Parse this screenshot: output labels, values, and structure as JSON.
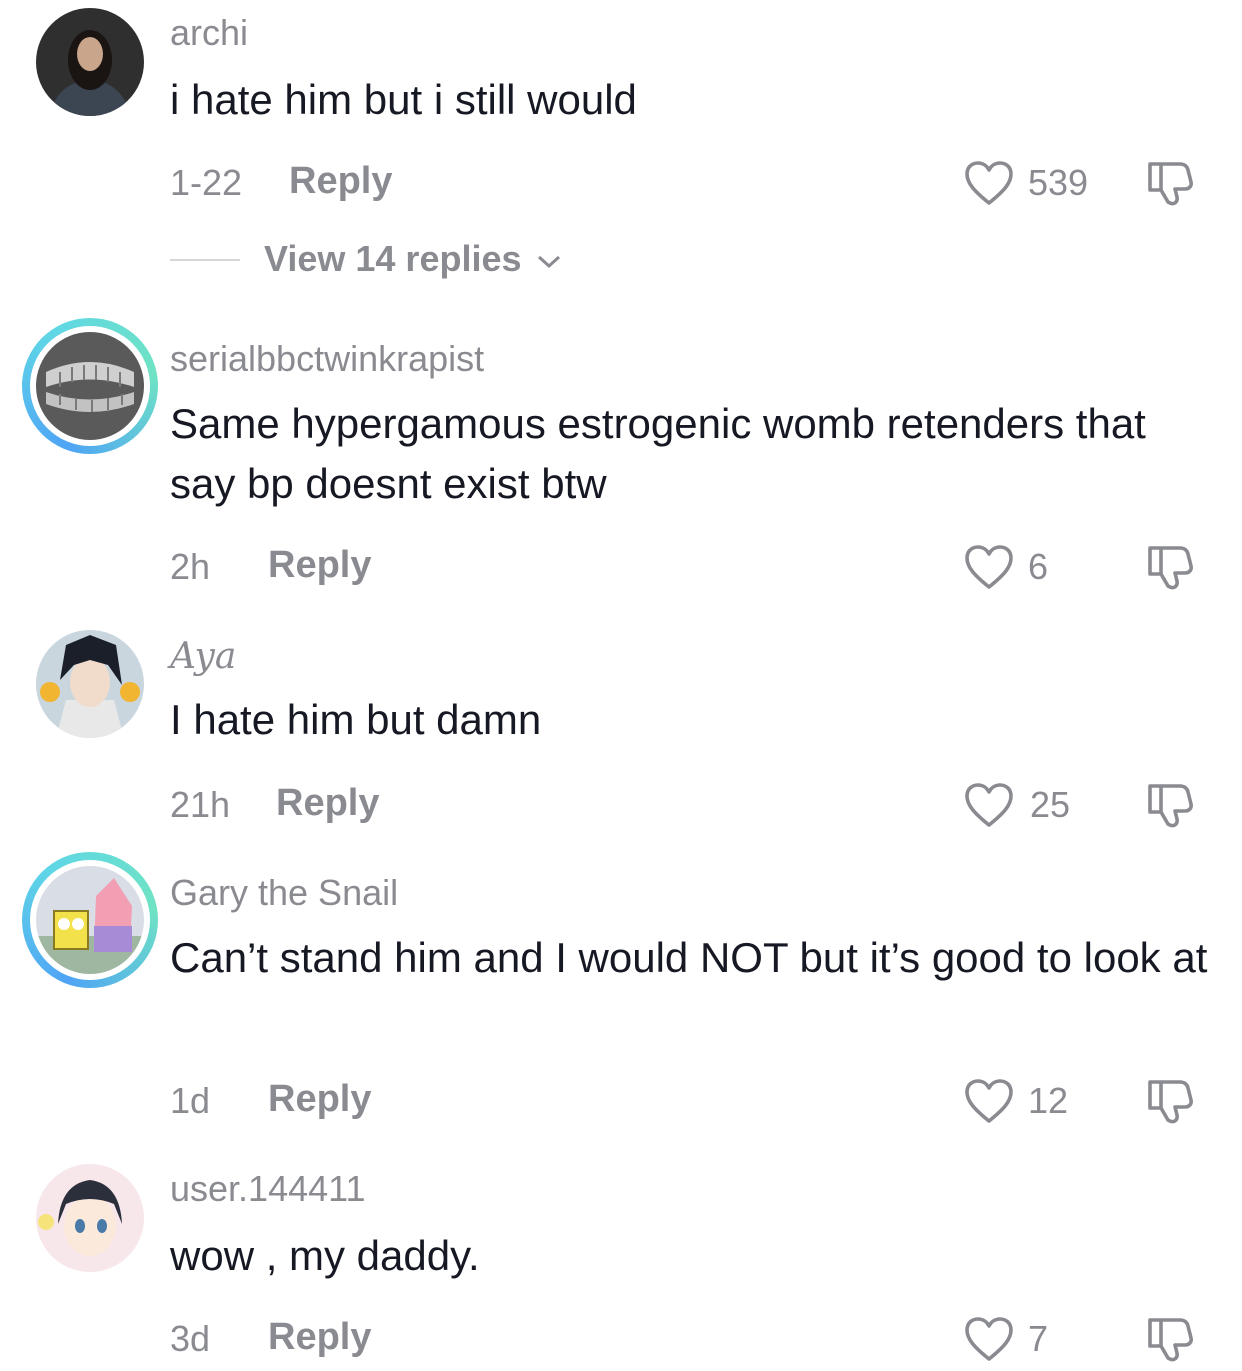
{
  "comments": [
    {
      "username": "archi",
      "text": "i hate him but i still would",
      "time": "1-22",
      "reply": "Reply",
      "likes": "539",
      "view_replies": "View 14 replies"
    },
    {
      "username": "serialbbctwinkrapist",
      "text": "Same hypergamous estrogenic womb retenders that say bp doesnt exist btw",
      "time": "2h",
      "reply": "Reply",
      "likes": "6"
    },
    {
      "username": "Aya",
      "text": "I hate him but damn",
      "time": "21h",
      "reply": "Reply",
      "likes": "25"
    },
    {
      "username": "Gary the Snail",
      "text": "Can’t stand him and I would NOT but it’s good to look at",
      "time": "1d",
      "reply": "Reply",
      "likes": "12"
    },
    {
      "username": "user.144411",
      "text": "wow , my daddy.",
      "time": "3d",
      "reply": "Reply",
      "likes": "7"
    }
  ],
  "icons": {
    "like": "heart-outline-icon",
    "dislike": "thumbs-down-icon",
    "expand": "chevron-down-icon"
  }
}
